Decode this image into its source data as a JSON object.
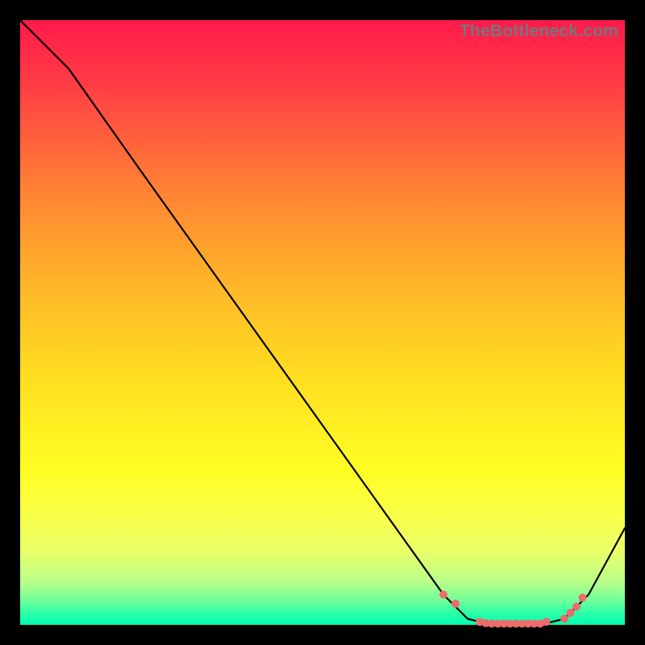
{
  "watermark": "TheBottleneck.com",
  "chart_data": {
    "type": "line",
    "title": "",
    "xlabel": "",
    "ylabel": "",
    "xlim": [
      0,
      100
    ],
    "ylim": [
      0,
      100
    ],
    "grid": false,
    "legend": false,
    "series": [
      {
        "name": "bottleneck-curve",
        "x": [
          0,
          8,
          20,
          30,
          40,
          50,
          60,
          70,
          74,
          78,
          82,
          86,
          90,
          94,
          100
        ],
        "y": [
          100,
          92,
          75,
          61,
          47,
          33,
          19,
          5,
          1,
          0,
          0,
          0,
          1,
          5,
          16
        ],
        "color": "#000000"
      }
    ],
    "markers": {
      "name": "selected-points",
      "color": "#ef6b6b",
      "radius": 5,
      "x": [
        70,
        72,
        76,
        77,
        78,
        79,
        80,
        81,
        82,
        83,
        84,
        85,
        86,
        87,
        90,
        91,
        92,
        93
      ],
      "y": [
        5,
        3.5,
        0.5,
        0.3,
        0.2,
        0.2,
        0.2,
        0.2,
        0.2,
        0.2,
        0.2,
        0.2,
        0.2,
        0.5,
        1,
        2,
        3,
        4.5
      ]
    },
    "background_gradient": {
      "top": "#ff1a4b",
      "mid": "#ffff25",
      "bottom": "#00ffb0"
    }
  }
}
